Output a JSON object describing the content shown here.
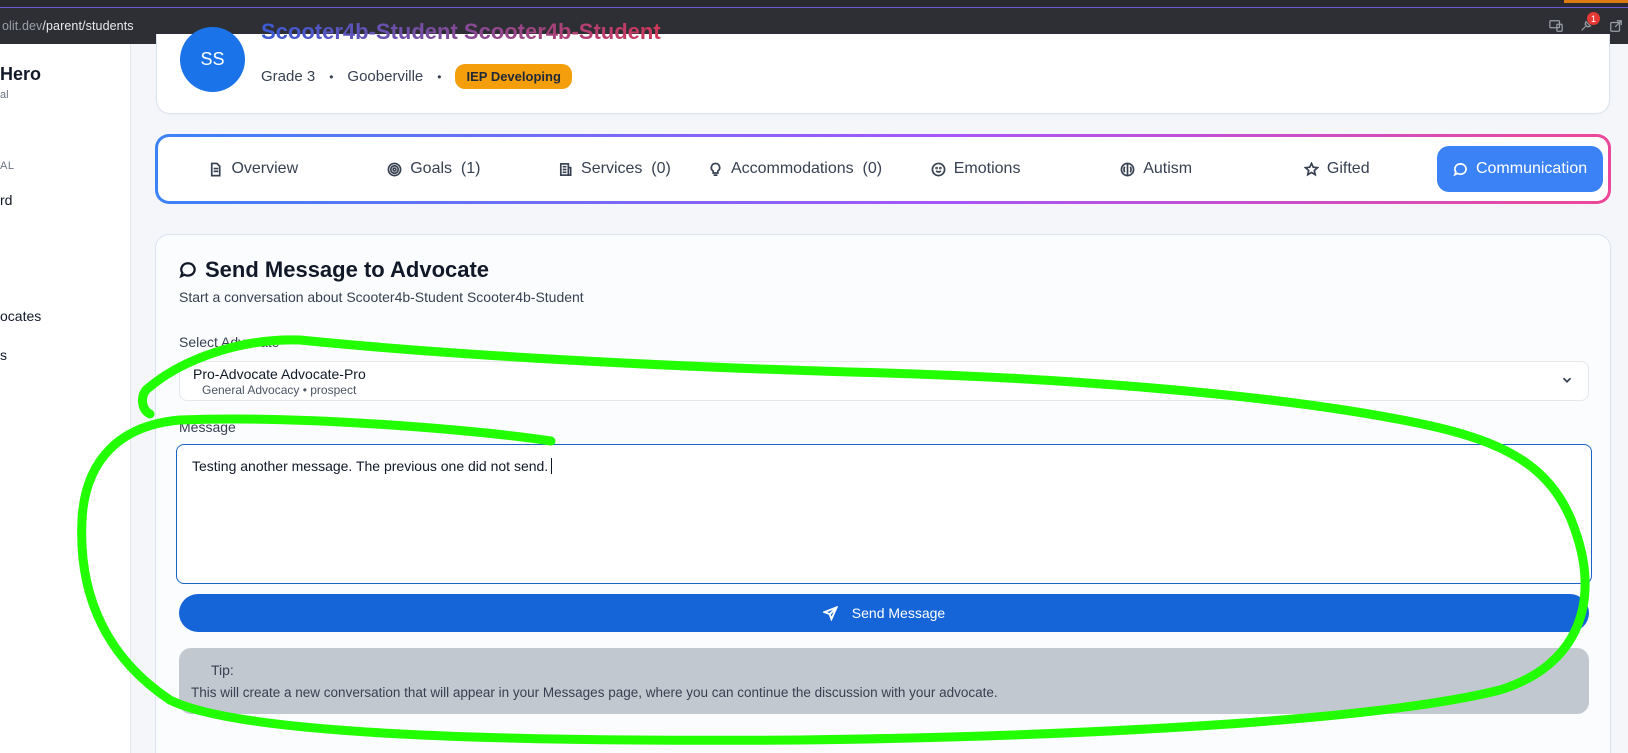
{
  "browser": {
    "url_host_fragment": "olit.dev",
    "url_path": "/parent/students",
    "notification_count": "1"
  },
  "sidebar": {
    "brand": "Hero",
    "brand_sub": "al",
    "section_label": "AL",
    "items": [
      {
        "label": "rd"
      },
      {
        "label": "ocates"
      },
      {
        "label": "s"
      }
    ]
  },
  "student": {
    "initials": "SS",
    "name": "Scooter4b-Student Scooter4b-Student",
    "grade": "Grade 3",
    "separator": "•",
    "school": "Gooberville",
    "status_badge": "IEP Developing"
  },
  "tabs": [
    {
      "label": "Overview",
      "icon": "document-icon"
    },
    {
      "label": "Goals  (1)",
      "icon": "target-icon"
    },
    {
      "label": "Services  (0)",
      "icon": "building-icon"
    },
    {
      "label": "Accommodations  (0)",
      "icon": "lightbulb-icon"
    },
    {
      "label": "Emotions",
      "icon": "smile-icon"
    },
    {
      "label": "Autism",
      "icon": "brain-icon"
    },
    {
      "label": "Gifted",
      "icon": "star-icon"
    },
    {
      "label": "Communication",
      "icon": "chat-bubble-icon",
      "active": true
    }
  ],
  "message_form": {
    "title": "Send Message to Advocate",
    "subtitle": "Start a conversation about Scooter4b-Student Scooter4b-Student",
    "select_label": "Select Advocate",
    "selected_advocate_name": "Pro-Advocate Advocate-Pro",
    "selected_advocate_desc": "General Advocacy • prospect",
    "message_label": "Message",
    "message_value": "Testing another message. The previous one did not send.",
    "send_label": "Send Message",
    "tip_title": "Tip:",
    "tip_text": "This will create a new conversation that will appear in your Messages page, where you can continue the discussion with your advocate."
  },
  "colors": {
    "primary": "#1565d8",
    "active_tab": "#3b82f6",
    "badge": "#f59e0b",
    "annotation": "#22ff00"
  }
}
